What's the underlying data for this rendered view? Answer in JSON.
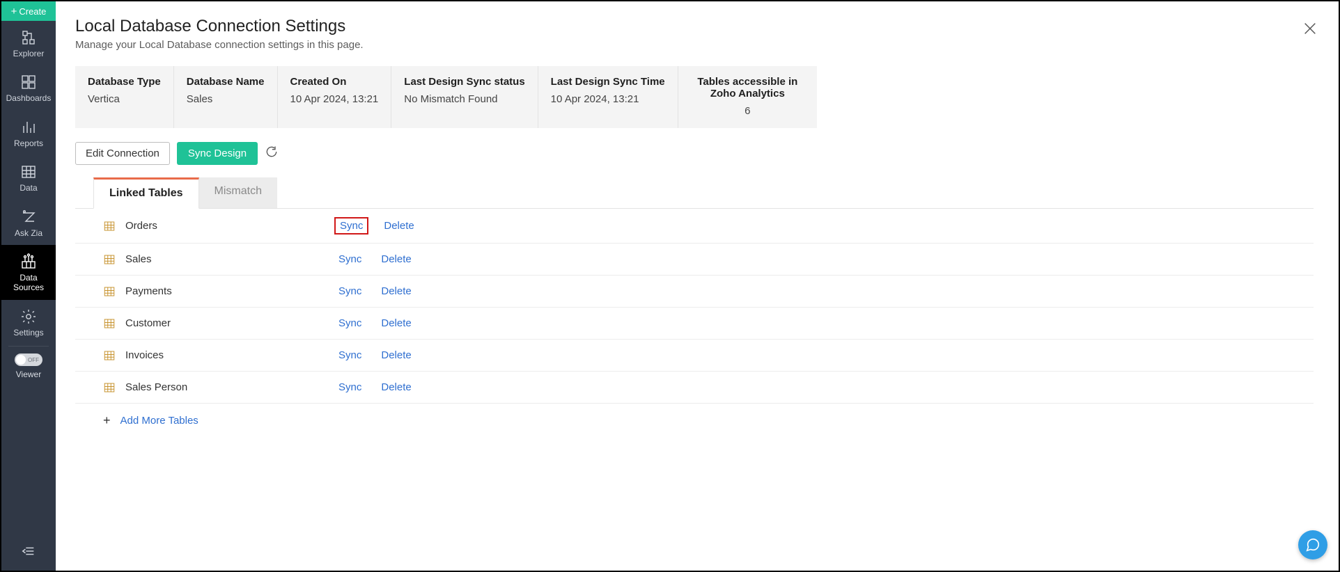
{
  "create_label": "Create",
  "nav": {
    "explorer": "Explorer",
    "dashboards": "Dashboards",
    "reports": "Reports",
    "data": "Data",
    "askzia": "Ask Zia",
    "datasources": "Data\nSources",
    "settings": "Settings",
    "viewer": "Viewer",
    "toggle_label": "OFF"
  },
  "header": {
    "title": "Local Database Connection Settings",
    "subtitle": "Manage your Local Database connection settings in this page."
  },
  "summary": [
    {
      "label": "Database Type",
      "value": "Vertica"
    },
    {
      "label": "Database Name",
      "value": "Sales"
    },
    {
      "label": "Created On",
      "value": "10 Apr 2024, 13:21"
    },
    {
      "label": "Last Design Sync status",
      "value": "No Mismatch Found"
    },
    {
      "label": "Last Design Sync Time",
      "value": "10 Apr 2024, 13:21"
    },
    {
      "label": "Tables accessible in Zoho Analytics",
      "value": "6"
    }
  ],
  "actions": {
    "edit": "Edit Connection",
    "sync_design": "Sync Design"
  },
  "tabs": {
    "linked": "Linked Tables",
    "mismatch": "Mismatch"
  },
  "row_actions": {
    "sync": "Sync",
    "delete": "Delete"
  },
  "tables": [
    {
      "name": "Orders",
      "highlighted": true
    },
    {
      "name": "Sales"
    },
    {
      "name": "Payments"
    },
    {
      "name": "Customer"
    },
    {
      "name": "Invoices"
    },
    {
      "name": "Sales Person"
    }
  ],
  "add_more": "Add More Tables"
}
